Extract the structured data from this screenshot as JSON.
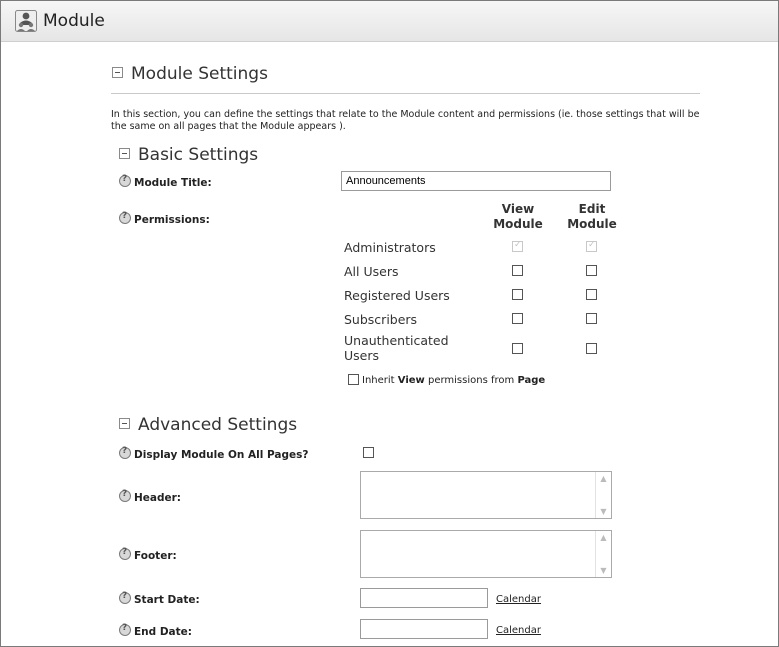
{
  "window": {
    "title": "Module"
  },
  "module_settings": {
    "heading": "Module Settings",
    "intro": "In this section, you can define the settings that relate to the Module content and permissions (ie. those settings that will be the same on all pages that the Module appears )."
  },
  "basic_settings": {
    "heading": "Basic Settings",
    "module_title_label": "Module Title:",
    "module_title_value": "Announcements",
    "permissions_label": "Permissions:",
    "columns": {
      "view": "View\nModule",
      "edit": "Edit\nModule"
    },
    "roles": [
      {
        "name": "Administrators",
        "view": true,
        "edit": true,
        "disabled": true
      },
      {
        "name": "All Users",
        "view": false,
        "edit": false
      },
      {
        "name": "Registered Users",
        "view": false,
        "edit": false
      },
      {
        "name": "Subscribers",
        "view": false,
        "edit": false
      },
      {
        "name": "Unauthenticated\nUsers",
        "view": false,
        "edit": false
      }
    ],
    "inherit_pre": "Inherit ",
    "inherit_view": "View",
    "inherit_mid": " permissions from ",
    "inherit_page": "Page"
  },
  "advanced_settings": {
    "heading": "Advanced Settings",
    "display_all_label": "Display Module On All Pages?",
    "header_label": "Header:",
    "footer_label": "Footer:",
    "start_date_label": "Start Date:",
    "end_date_label": "End Date:",
    "calendar_label": "Calendar"
  },
  "icons": {
    "module": "module-users-icon",
    "help": "help-icon",
    "collapse": "collapse-icon"
  }
}
